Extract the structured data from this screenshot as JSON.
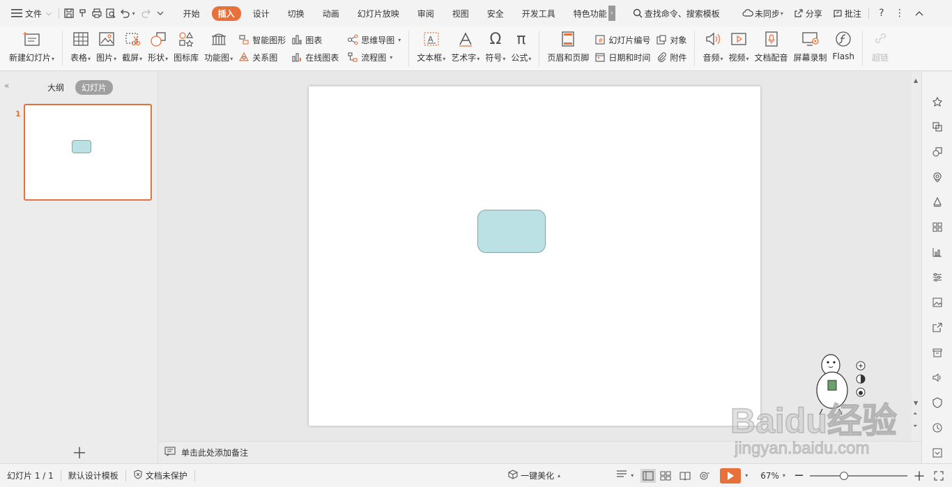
{
  "menubar": {
    "file_label": "文件",
    "tabs": [
      {
        "label": "开始"
      },
      {
        "label": "插入",
        "active": true
      },
      {
        "label": "设计"
      },
      {
        "label": "切换"
      },
      {
        "label": "动画"
      },
      {
        "label": "幻灯片放映"
      },
      {
        "label": "审阅"
      },
      {
        "label": "视图"
      },
      {
        "label": "安全"
      },
      {
        "label": "开发工具"
      },
      {
        "label": "特色功能"
      }
    ],
    "search_placeholder": "查找命令、搜索模板",
    "sync_label": "未同步",
    "share_label": "分享",
    "comment_label": "批注"
  },
  "ribbon": {
    "new_slide": "新建幻灯片",
    "table": "表格",
    "picture": "图片",
    "screenshot": "截屏",
    "shape": "形状",
    "icon_lib": "图标库",
    "func_chart": "功能图",
    "smart_shape": "智能图形",
    "chart": "图表",
    "relation": "关系图",
    "online_chart": "在线图表",
    "mindmap": "思维导图",
    "flowchart": "流程图",
    "textbox": "文本框",
    "wordart": "艺术字",
    "symbol": "符号",
    "formula": "公式",
    "header_footer": "页眉和页脚",
    "slide_number": "幻灯片编号",
    "object": "对象",
    "date_time": "日期和时间",
    "attachment": "附件",
    "audio": "音频",
    "video": "视频",
    "doc_voice": "文档配音",
    "screen_record": "屏幕录制",
    "flash": "Flash",
    "hyperlink": "超链"
  },
  "leftpanel": {
    "outline_tab": "大纲",
    "slides_tab": "幻灯片",
    "slide_number": "1"
  },
  "notes": {
    "placeholder": "单击此处添加备注"
  },
  "statusbar": {
    "slide_counter": "幻灯片 1 / 1",
    "template": "默认设计模板",
    "protection": "文档未保护",
    "beautify": "一键美化",
    "zoom": "67%"
  },
  "colors": {
    "accent": "#e8703a",
    "shape_fill": "#bce1e4",
    "shape_border": "#7fa8ab"
  },
  "watermark": {
    "brand": "Baidu经验",
    "url": "jingyan.baidu.com"
  }
}
